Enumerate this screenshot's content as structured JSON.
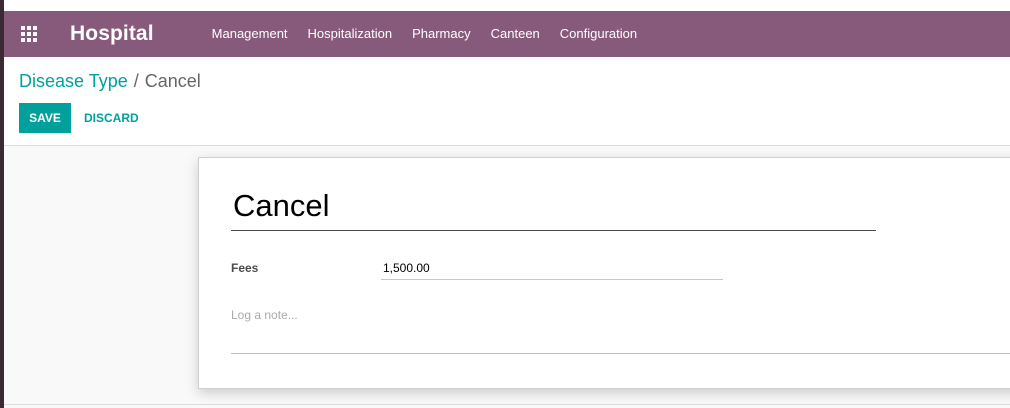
{
  "navbar": {
    "brand": "Hospital",
    "menu": [
      {
        "label": "Management"
      },
      {
        "label": "Hospitalization"
      },
      {
        "label": "Pharmacy"
      },
      {
        "label": "Canteen"
      },
      {
        "label": "Configuration"
      }
    ]
  },
  "breadcrumb": {
    "parent": "Disease Type",
    "separator": "/",
    "current": "Cancel"
  },
  "buttons": {
    "save": "SAVE",
    "discard": "DISCARD"
  },
  "form": {
    "name": "Cancel",
    "fees_label": "Fees",
    "fees_value": "1,500.00",
    "note_placeholder": "Log a note..."
  },
  "colors": {
    "navbar": "#875a7b",
    "accent": "#00a09d"
  }
}
